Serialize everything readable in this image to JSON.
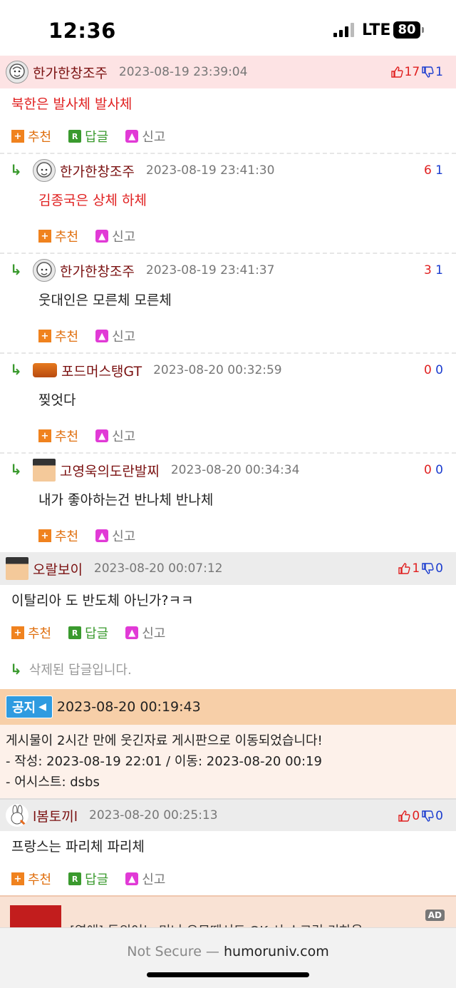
{
  "status": {
    "time": "12:36",
    "network": "LTE",
    "battery": "80"
  },
  "comments": [
    {
      "nick": "한가한창조주",
      "date": "2023-08-19 23:39:04",
      "up": "17",
      "down": "1",
      "body": "북한은 발사체 발사체",
      "actions": {
        "recommend": "추천",
        "reply": "답글",
        "report": "신고"
      },
      "replies": [
        {
          "nick": "한가한창조주",
          "date": "2023-08-19 23:41:30",
          "up": "6",
          "down": "1",
          "body": "김종국은 상체 하체",
          "actions": {
            "recommend": "추천",
            "report": "신고"
          }
        },
        {
          "nick": "한가한창조주",
          "date": "2023-08-19 23:41:37",
          "up": "3",
          "down": "1",
          "body": "웃대인은 모른체 모른체",
          "actions": {
            "recommend": "추천",
            "report": "신고"
          }
        },
        {
          "nick": "포드머스탱GT",
          "date": "2023-08-20 00:32:59",
          "up": "0",
          "down": "0",
          "body": "찢엇다",
          "actions": {
            "recommend": "추천",
            "report": "신고"
          }
        },
        {
          "nick": "고영욱의도란발찌",
          "date": "2023-08-20 00:34:34",
          "up": "0",
          "down": "0",
          "body": "내가 좋아하는건 반나체 반나체",
          "actions": {
            "recommend": "추천",
            "report": "신고"
          }
        }
      ]
    },
    {
      "nick": "오랄보이",
      "date": "2023-08-20 00:07:12",
      "up": "1",
      "down": "0",
      "body": "이탈리아 도 반도체 아닌가?ㅋㅋ",
      "actions": {
        "recommend": "추천",
        "reply": "답글",
        "report": "신고"
      },
      "deleted_reply": "삭제된 답글입니다."
    },
    {
      "nick": "l봄토끼l",
      "date": "2023-08-20 00:25:13",
      "up": "0",
      "down": "0",
      "body": "프랑스는 파리체 파리체",
      "actions": {
        "recommend": "추천",
        "reply": "답글",
        "report": "신고"
      }
    }
  ],
  "notice": {
    "badge": "공지",
    "date": "2023-08-20 00:19:43",
    "lines": [
      "게시물이 2시간 만에 웃긴자료 게시판으로 이동되었습니다!",
      "- 작성: 2023-08-19 22:01 / 이동: 2023-08-20 00:19",
      "- 어시스트: dsbs"
    ]
  },
  "ad": {
    "badge": "AD",
    "text": "[영애] 동의어노 미니 오모때서드 OK 시 스크린 키하음"
  },
  "browser": {
    "not_secure": "Not Secure —",
    "domain": "humoruniv.com"
  },
  "colors": {
    "up": "#e02020",
    "down": "#1a3ccf",
    "nick": "#7a1010",
    "recommend": "#f0821e",
    "reply": "#3a9a2e",
    "report": "#e13ad6"
  }
}
